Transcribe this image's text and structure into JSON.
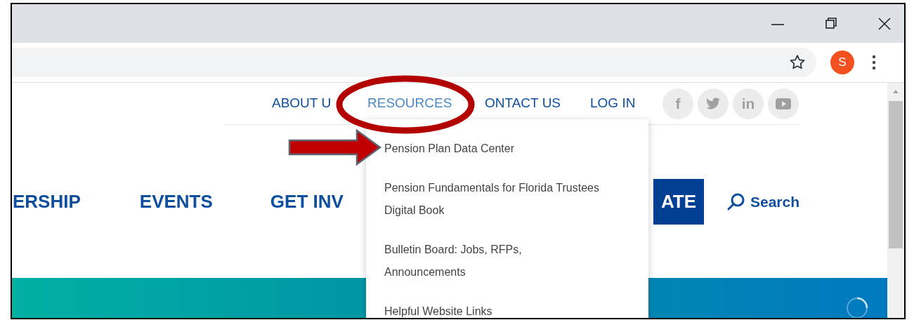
{
  "browser": {
    "profile_initial": "S"
  },
  "top_nav": [
    {
      "label": "ABOUT U",
      "selected": false
    },
    {
      "label": "RESOURCES",
      "selected": true
    },
    {
      "label": "ONTACT US",
      "selected": false
    },
    {
      "label": "LOG IN",
      "selected": false
    }
  ],
  "social": [
    {
      "kind": "facebook",
      "glyph": "f"
    },
    {
      "kind": "twitter"
    },
    {
      "kind": "linkedin",
      "glyph": "in"
    },
    {
      "kind": "youtube"
    }
  ],
  "main_nav": [
    {
      "label": "ERSHIP"
    },
    {
      "label": "EVENTS"
    },
    {
      "label": "GET INV"
    }
  ],
  "cta_button": "ATE",
  "search": "Search",
  "dropdown": [
    {
      "lines": [
        "Pension Plan Data Center"
      ]
    },
    {
      "lines": [
        "Pension Fundamentals for Florida Trustees",
        "Digital Book"
      ]
    },
    {
      "lines": [
        "Bulletin Board: Jobs, RFPs,",
        "Announcements"
      ]
    },
    {
      "lines": [
        "Helpful Website Links"
      ]
    }
  ]
}
